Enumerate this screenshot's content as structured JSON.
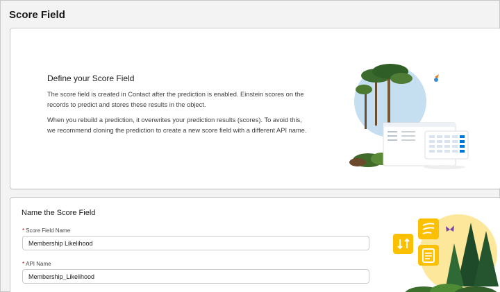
{
  "page": {
    "title": "Score Field"
  },
  "define_section": {
    "heading": "Define your Score Field",
    "paragraph_1": "The score field is created in Contact after the prediction is enabled. Einstein scores on the records to predict and stores these results in the object.",
    "paragraph_2": "When you rebuild a prediction, it overwrites your prediction results (scores). To avoid this, we recommend cloning the prediction to create a new score field with a different API name."
  },
  "name_section": {
    "heading": "Name the Score Field",
    "required_marker": "*",
    "score_field_name": {
      "label": "Score Field Name",
      "value": "Membership Likelihood"
    },
    "api_name": {
      "label": "API Name",
      "value": "Membership_Likelihood"
    }
  },
  "colors": {
    "required": "#ba0517",
    "accent_blue": "#0176d3",
    "tile_yellow": "#fcc003",
    "tree_green": "#3b6b2d"
  }
}
